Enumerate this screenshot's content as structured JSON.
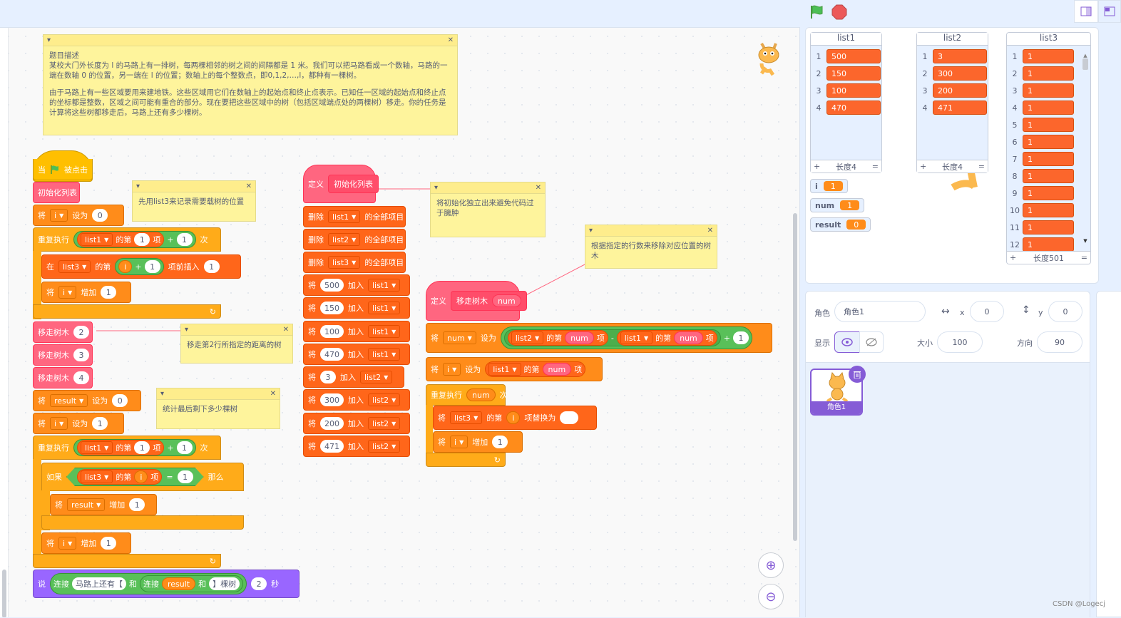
{
  "toolbar": {
    "flag": "green-flag",
    "stop": "stop"
  },
  "notes": {
    "problem_title": "题目描述",
    "problem_text1": "某校大门外长度为 l 的马路上有一排树，每两棵相邻的树之间的间隔都是 1 米。我们可以把马路看成一个数轴，马路的一端在数轴 0 的位置，另一端在 l 的位置；数轴上的每个整数点，即0,1,2,…,l，都种有一棵树。",
    "problem_text2": "由于马路上有一些区域要用来建地铁。这些区域用它们在数轴上的起始点和终止点表示。已知任一区域的起始点和终止点的坐标都是整数，区域之间可能有重合的部分。现在要把这些区域中的树（包括区域端点处的两棵树）移走。你的任务是计算将这些树都移走后，马路上还有多少棵树。",
    "n1": "先用list3来记录需要载树的位置",
    "n2": "将初始化独立出来避免代码过于臃肿",
    "n3": "根据指定的行数来移除对应位置的树木",
    "n4": "移走第2行所指定的距离的树",
    "n5": "统计最后剩下多少棵树"
  },
  "script1": {
    "when": "当",
    "clicked": "被点击",
    "init": "初始化列表",
    "set": "将",
    "to": "设为",
    "change": "增加",
    "by": "增加",
    "i": "i",
    "zero": "0",
    "one": "1",
    "repeat": "重复执行",
    "times": "次",
    "list1": "list1",
    "list3": "list3",
    "item_of": "的第",
    "item": "项",
    "plus": "+",
    "insert_at": "在",
    "insert_of": "的第",
    "insert_before": "项前插入",
    "remove_tree": "移走树木",
    "r2": "2",
    "r3": "3",
    "r4": "4",
    "result": "result",
    "if": "如果",
    "then": "那么",
    "eq": "=",
    "say": "说",
    "join": "连接",
    "and": "和",
    "road_left": "马路上还有【",
    "trees": "】棵树",
    "secs": "秒",
    "two": "2"
  },
  "script2": {
    "define": "定义",
    "name": "初始化列表",
    "delete": "删除",
    "all": "的全部项目",
    "l1": "list1",
    "l2": "list2",
    "l3": "list3",
    "set": "将",
    "add": "加入",
    "v1": "500",
    "v2": "150",
    "v3": "100",
    "v4": "470",
    "v5": "3",
    "v6": "300",
    "v7": "200",
    "v8": "471"
  },
  "script3": {
    "define": "定义",
    "name": "移走树木",
    "arg": "num",
    "set": "将",
    "to": "设为",
    "num": "num",
    "i": "i",
    "list2": "list2",
    "list1": "list1",
    "list3": "list3",
    "item_of": "的第",
    "item": "项",
    "minus": "-",
    "plus": "+",
    "one": "1",
    "repeat": "重复执行",
    "times": "次",
    "replace": "项替换为",
    "change": "增加"
  },
  "stage": {
    "list1": {
      "title": "list1",
      "items": [
        "500",
        "150",
        "100",
        "470"
      ],
      "length": "长度4"
    },
    "list2": {
      "title": "list2",
      "items": [
        "3",
        "300",
        "200",
        "471"
      ],
      "length": "长度4"
    },
    "list3": {
      "title": "list3",
      "items": [
        "1",
        "1",
        "1",
        "1",
        "1",
        "1",
        "1",
        "1",
        "1",
        "1",
        "1",
        "1"
      ],
      "length": "长度501"
    },
    "vars": [
      {
        "name": "i",
        "value": "1"
      },
      {
        "name": "num",
        "value": "1"
      },
      {
        "name": "result",
        "value": "0"
      }
    ],
    "plus": "+",
    "eq": "="
  },
  "sprite": {
    "sprite_label": "角色",
    "sprite_name": "角色1",
    "x_label": "x",
    "x": "0",
    "y_label": "y",
    "y": "0",
    "show_label": "显示",
    "size_label": "大小",
    "size": "100",
    "direction_label": "方向",
    "direction": "90",
    "thumb_name": "角色1"
  },
  "watermark": "CSDN @Logecj"
}
